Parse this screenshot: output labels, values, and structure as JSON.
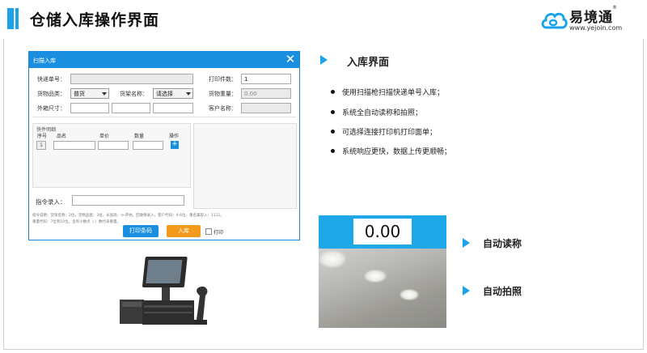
{
  "slide": {
    "title": "仓储入库操作界面",
    "logo_text": "易境通",
    "logo_trademark": "®",
    "logo_url": "www.yejoin.com"
  },
  "dialog": {
    "title": "扫描入库",
    "close_icon": "close-icon",
    "fields": {
      "tracking_no_label": "快递单号：",
      "tracking_no_value": "",
      "print_count_label": "打印件数：",
      "print_count_value": "1",
      "category_label": "货物品类：",
      "category_value": "普货",
      "shelf_label": "货架名称：",
      "shelf_value": "请选择",
      "weight_label": "货物重量：",
      "weight_value": "0.00",
      "box_size_label": "外箱尺寸：",
      "customer_label": "客户名称：",
      "command_label": "指令录入："
    },
    "detail": {
      "title": "快件明细",
      "columns": [
        "序号",
        "品名",
        "单价",
        "数量",
        "操作"
      ],
      "row_no": "1",
      "add_label": "+"
    },
    "hint_lines": [
      "指令说明：货架名称：2位，货物品类：3位，长宽高：⊙-开始，回收保录入，客户代码：4-6位，重名兼容入：1111。",
      "重量代码：7位到10位，含有小数点（.）数代表重量。"
    ],
    "print_barcode_label": "打印条码",
    "inbound_label": "入库",
    "print_checkbox_label": "打印"
  },
  "features": {
    "section_title": "入库界面",
    "bullets": [
      "使用扫描枪扫描快递单号入库；",
      "系统全自动读称和拍照；",
      "可选择连接打印机打印面单；",
      "系统响应更快，数据上传更顺畅；"
    ],
    "auto_weigh_label": "自动读称",
    "auto_photo_label": "自动拍照"
  },
  "scale": {
    "reading": "0.00"
  },
  "colors": {
    "accent_blue": "#1aa3e8",
    "dialog_blue": "#1a8fe0",
    "inbound_orange": "#f39a1d"
  }
}
